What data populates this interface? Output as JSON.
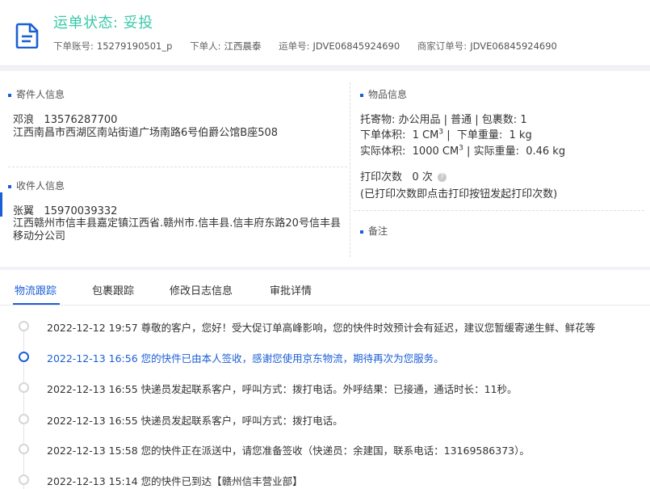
{
  "header": {
    "status_title": "运单状态: 妥投",
    "order_account_label": "下单账号:",
    "order_account": "15279190501_p",
    "order_person_label": "下单人:",
    "order_person": "江西晨泰",
    "waybill_label": "运单号:",
    "waybill": "JDVE06845924690",
    "merchant_order_label": "商家订单号:",
    "merchant_order": "JDVE06845924690"
  },
  "sender": {
    "title": "寄件人信息",
    "name": "邓浪",
    "phone": "13576287700",
    "address": "江西南昌市西湖区南站街道广场南路6号伯爵公馆B座508"
  },
  "receiver": {
    "title": "收件人信息",
    "name": "张翼",
    "phone": "15970039332",
    "address": "江西赣州市信丰县嘉定镇江西省.赣州市.信丰县.信丰府东路20号信丰县移动分公司"
  },
  "goods": {
    "title": "物品信息",
    "contents_line": "托寄物:  办公用品 | 普通  |  包裹数:  1",
    "order_volume_label": "下单体积:",
    "order_volume": "1 CM",
    "order_volume_unit_sup": "3",
    "order_weight_label": "下单重量:",
    "order_weight": "1 kg",
    "actual_volume_label": "实际体积:",
    "actual_volume": "1000 CM",
    "actual_volume_unit_sup": "3",
    "actual_weight_label": "实际重量:",
    "actual_weight": "0.46 kg",
    "print_count_label": "打印次数",
    "print_count": "0 次",
    "print_note": "(已打印次数即点击打印按钮发起打印次数)"
  },
  "remarks": {
    "title": "备注"
  },
  "tabs": [
    "物流跟踪",
    "包裹跟踪",
    "修改日志信息",
    "审批详情"
  ],
  "timeline": [
    {
      "time": "2022-12-12 19:57",
      "text": "尊敬的客户，您好！受大促订单高峰影响，您的快件时效预计会有延迟，建议您暂缓寄递生鲜、鲜花等",
      "current": false
    },
    {
      "time": "2022-12-13 16:56",
      "text": "您的快件已由本人签收，感谢您使用京东物流，期待再次为您服务。",
      "current": true
    },
    {
      "time": "2022-12-13 16:55",
      "text": "快递员发起联系客户，呼叫方式：拨打电话。外呼结果：已接通，通话时长：11秒。",
      "current": false
    },
    {
      "time": "2022-12-13 16:55",
      "text": "快递员发起联系客户，呼叫方式：拨打电话。",
      "current": false
    },
    {
      "time": "2022-12-13 15:58",
      "text": "您的快件正在派送中，请您准备签收（快递员：余建国，联系电话：13169586373）。",
      "current": false
    },
    {
      "time": "2022-12-13 15:14",
      "text": "您的快件已到达【赣州信丰营业部】",
      "current": false
    }
  ],
  "colors": {
    "accent": "#1a5fd6",
    "status_green": "#3ac9a8"
  }
}
